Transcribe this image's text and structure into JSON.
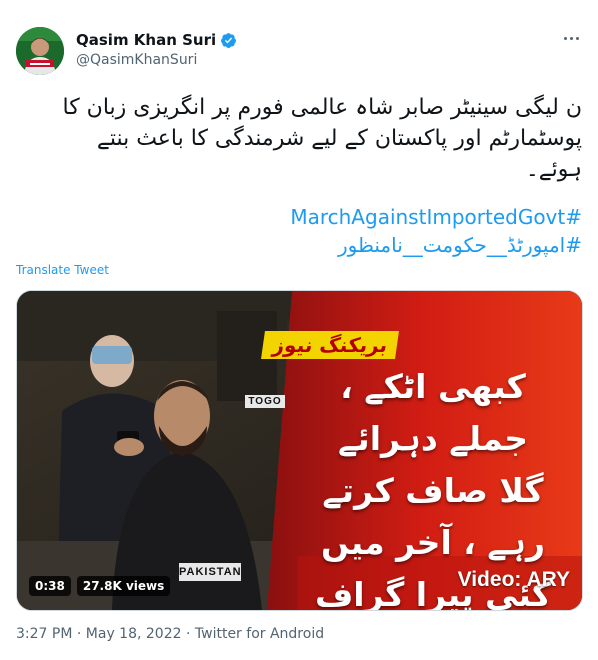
{
  "author": {
    "display_name": "Qasim Khan Suri",
    "handle": "@QasimKhanSuri",
    "verified": true
  },
  "tweet": {
    "text_line1": "ن لیگی سینیٹر صابر شاہ عالمی فورم پر انگریزی زبان کا",
    "text_line2": "پوسٹمارٹم اور پاکستان  کے لیے شرمندگی کا باعث بنتے",
    "text_line3": "ہوئے۔",
    "hashtags": [
      "#MarchAgainstImportedGovt",
      "#امپورٹڈ__حکومت__نامنظور"
    ],
    "translate_label": "Translate Tweet"
  },
  "video": {
    "duration": "0:38",
    "views": "27.8K views",
    "credit": "Video: ARY",
    "news_tag": "بریکنگ نیوز",
    "overlay_lines": [
      "کبھی اٹکے ، جملے دہرائے",
      "گلا صاف کرتے رہے ، آخر میں",
      "کئی پیرا گراف چھوڑدیے"
    ],
    "sign_togo": "TOGO",
    "sign_pakistan": "PAKISTAN"
  },
  "meta": {
    "time": "3:27 PM",
    "date": "May 18, 2022",
    "source": "Twitter for Android",
    "separator": "·"
  },
  "colors": {
    "link": "#1d9bf0",
    "secondary_text": "#536471",
    "verified": "#1d9bf0"
  }
}
